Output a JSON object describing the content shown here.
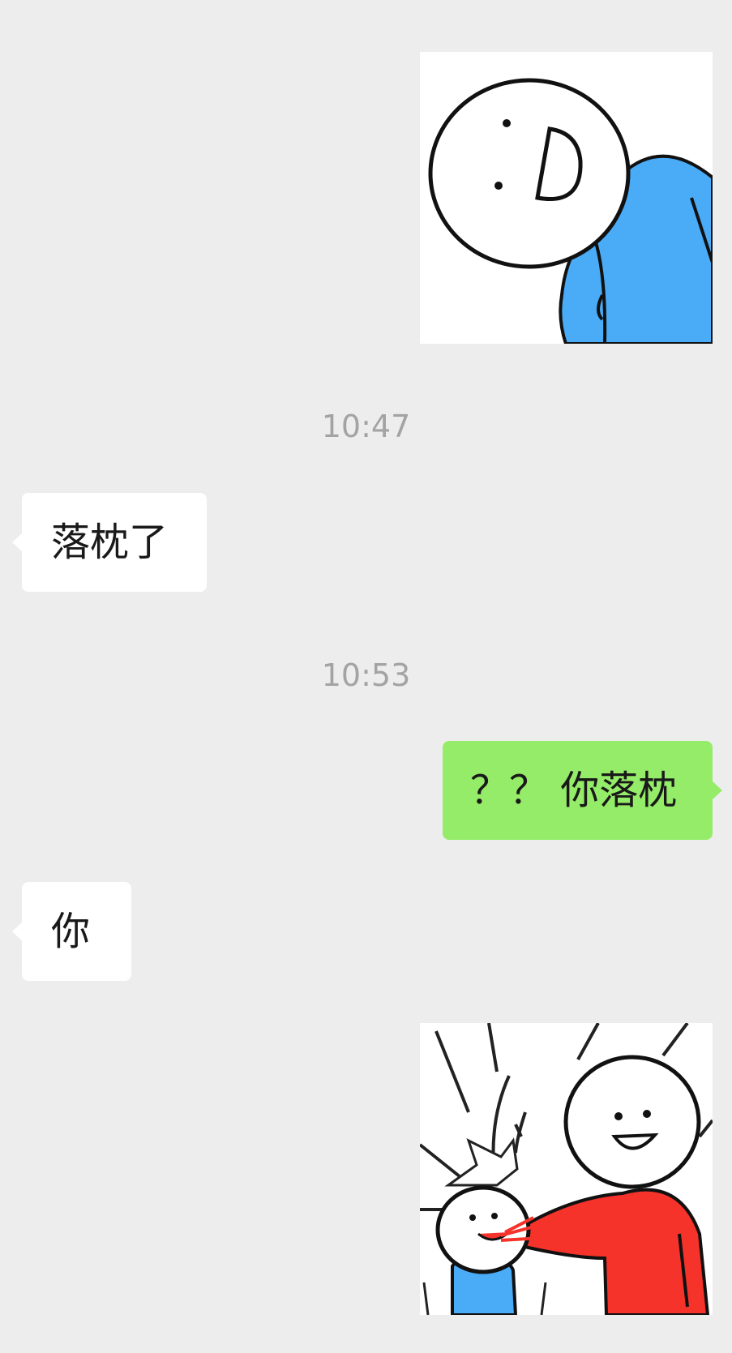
{
  "messages": [
    {
      "type": "sticker",
      "side": "right",
      "sticker": "peeking-blue-stickman-sticker"
    },
    {
      "type": "timestamp",
      "text": "10:47"
    },
    {
      "type": "text",
      "side": "left",
      "text": "落枕了"
    },
    {
      "type": "timestamp",
      "text": "10:53"
    },
    {
      "type": "text",
      "side": "right",
      "text": "？？ 你落枕"
    },
    {
      "type": "text",
      "side": "left",
      "text": "你"
    },
    {
      "type": "sticker",
      "side": "right",
      "sticker": "red-stickman-chopping-blue-stickman-sticker"
    }
  ],
  "colors": {
    "background": "#ededed",
    "incoming_bubble": "#ffffff",
    "outgoing_bubble": "#95ec69",
    "timestamp": "#a3a3a3",
    "shirt_blue": "#4aabf7",
    "shirt_red": "#f5332a"
  }
}
